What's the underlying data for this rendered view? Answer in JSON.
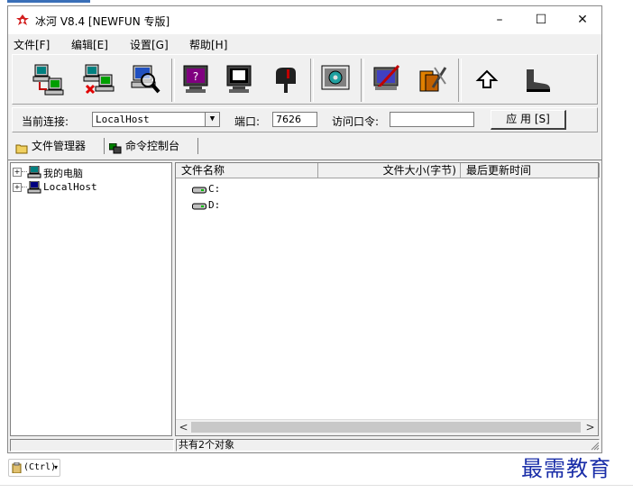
{
  "window": {
    "title": "冰河 V8.4 [NEWFUN 专版]",
    "controls": {
      "minimize": "–",
      "maximize": "☐",
      "close": "✕"
    }
  },
  "menu": [
    "文件[F]",
    "编辑[E]",
    "设置[G]",
    "帮助[H]"
  ],
  "toolbar": {
    "icons": [
      "connect-computer-icon",
      "disconnect-computer-icon",
      "search-computer-icon",
      "help-monitor-icon",
      "screen-capture-icon",
      "mailbox-icon",
      "settings-gear-icon",
      "edit-monitor-icon",
      "tools-icon",
      "back-arrow-icon",
      "boot-icon"
    ]
  },
  "connection": {
    "current_label": "当前连接:",
    "current_value": "LocalHost",
    "port_label": "端口:",
    "port_value": "7626",
    "password_label": "访问口令:",
    "password_value": "",
    "apply_label": "应 用 [S]"
  },
  "tabs": [
    {
      "label": "文件管理器",
      "icon": "folder-icon"
    },
    {
      "label": "命令控制台",
      "icon": "console-icon"
    }
  ],
  "tree": [
    {
      "label": "我的电脑",
      "icon": "my-computer-icon"
    },
    {
      "label": "LocalHost",
      "icon": "host-computer-icon"
    }
  ],
  "file_list": {
    "columns": [
      "文件名称",
      "文件大小(字节)",
      "最后更新时间"
    ],
    "rows": [
      {
        "name": "C:",
        "icon": "drive-icon"
      },
      {
        "name": "D:",
        "icon": "drive-icon"
      }
    ]
  },
  "status": {
    "text": "共有2个对象"
  },
  "taskbar": {
    "ctrl_label": "(Ctrl)"
  },
  "watermark": "最需教育",
  "colors": {
    "watermark": "#1a2ea8",
    "window_bg": "#f0f0f0",
    "accent": "#3a6fb8"
  }
}
